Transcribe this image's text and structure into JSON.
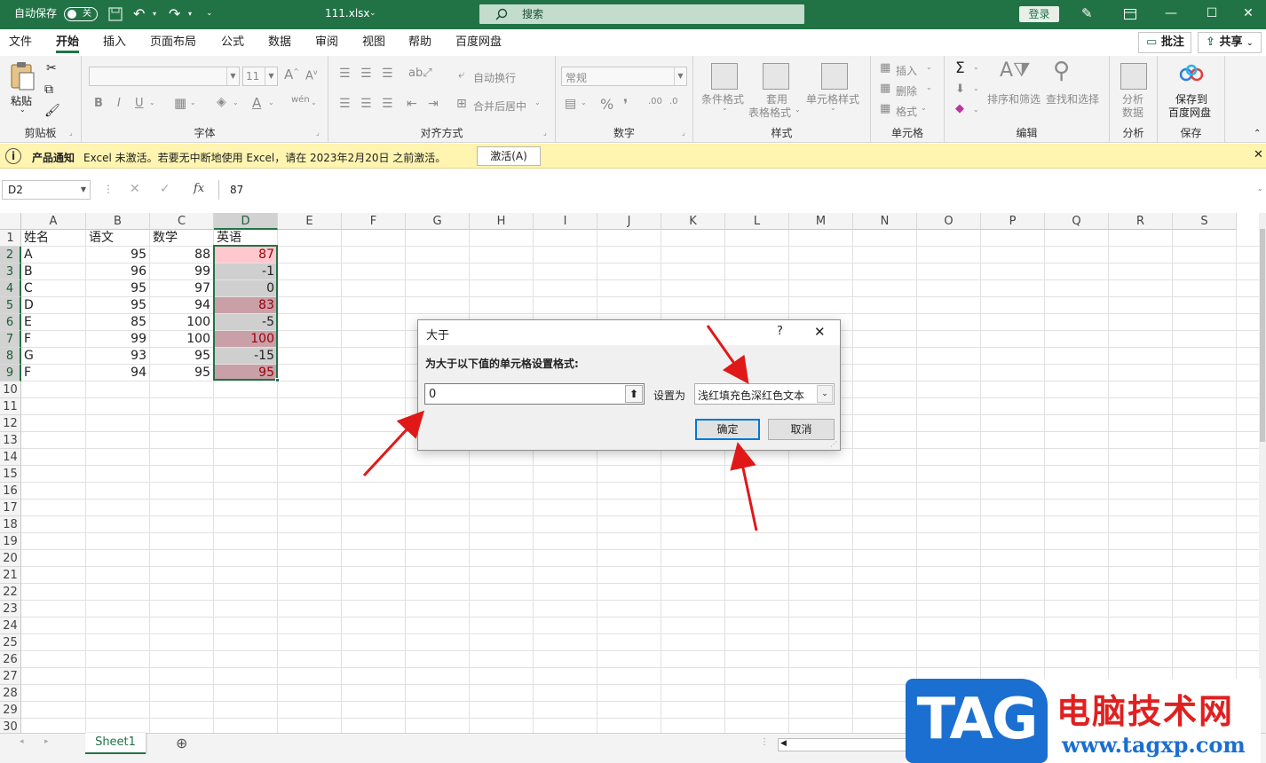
{
  "titlebar": {
    "autosave_label": "自动保存",
    "autosave_state": "关",
    "filename": "111.xlsx",
    "search_placeholder": "搜索",
    "login_label": "登录"
  },
  "menu": {
    "tabs": [
      "文件",
      "开始",
      "插入",
      "页面布局",
      "公式",
      "数据",
      "审阅",
      "视图",
      "帮助",
      "百度网盘"
    ],
    "active": "开始",
    "comment_label": "批注",
    "share_label": "共享"
  },
  "ribbon": {
    "paste_label": "粘贴",
    "clipboard_group": "剪贴板",
    "font_size": "11",
    "font_group": "字体",
    "wrap_text": "自动换行",
    "merge_center": "合并后居中",
    "align_group": "对齐方式",
    "number_format": "常规",
    "number_group": "数字",
    "cond_format": "条件格式",
    "table_format_1": "套用",
    "table_format_2": "表格格式",
    "cell_style": "单元格样式",
    "styles_group": "样式",
    "insert": "插入",
    "delete": "删除",
    "format": "格式",
    "cells_group": "单元格",
    "sort_filter": "排序和筛选",
    "find_select": "查找和选择",
    "editing_group": "编辑",
    "analyze_1": "分析",
    "analyze_2": "数据",
    "analysis_group": "分析",
    "save_baidu_1": "保存到",
    "save_baidu_2": "百度网盘",
    "save_group": "保存"
  },
  "notice": {
    "title": "产品通知",
    "message": "Excel 未激活。若要无中断地使用 Excel，请在 2023年2月20日 之前激活。",
    "button": "激活(A)"
  },
  "formula_bar": {
    "name_box": "D2",
    "fx": "fx",
    "value": "87"
  },
  "sheet": {
    "columns": [
      "A",
      "B",
      "C",
      "D",
      "E",
      "F",
      "G",
      "H",
      "I",
      "J",
      "K",
      "L",
      "M",
      "N",
      "O",
      "P",
      "Q",
      "R",
      "S"
    ],
    "row_numbers": [
      "1",
      "2",
      "3",
      "4",
      "5",
      "6",
      "7",
      "8",
      "9",
      "10",
      "11",
      "12",
      "13",
      "14",
      "15",
      "16",
      "17",
      "18",
      "19",
      "20",
      "21",
      "22",
      "23",
      "24",
      "25",
      "26",
      "27",
      "28",
      "29",
      "30"
    ],
    "header_row": [
      "姓名",
      "语文",
      "数学",
      "英语"
    ],
    "rows": [
      {
        "name": "A",
        "chinese": "95",
        "math": "88",
        "english": "87",
        "highlight": "light"
      },
      {
        "name": "B",
        "chinese": "96",
        "math": "99",
        "english": "-1",
        "highlight": "gray"
      },
      {
        "name": "C",
        "chinese": "95",
        "math": "97",
        "english": "0",
        "highlight": "gray"
      },
      {
        "name": "D",
        "chinese": "95",
        "math": "94",
        "english": "83",
        "highlight": "dark"
      },
      {
        "name": "E",
        "chinese": "85",
        "math": "100",
        "english": "-5",
        "highlight": "gray"
      },
      {
        "name": "F",
        "chinese": "99",
        "math": "100",
        "english": "100",
        "highlight": "dark"
      },
      {
        "name": "G",
        "chinese": "93",
        "math": "95",
        "english": "-15",
        "highlight": "gray"
      },
      {
        "name": "F",
        "chinese": "94",
        "math": "95",
        "english": "95",
        "highlight": "dark"
      }
    ],
    "colors": {
      "light": "#ffc7ce",
      "gray": "#cfcfcf",
      "dark": "#c9a0a8",
      "red_text": "#9c0006"
    }
  },
  "dialog": {
    "title": "大于",
    "help": "?",
    "prompt": "为大于以下值的单元格设置格式:",
    "input_value": "0",
    "set_as_label": "设置为",
    "format_option": "浅红填充色深红色文本",
    "ok": "确定",
    "cancel": "取消"
  },
  "sheet_tabs": {
    "active": "Sheet1"
  },
  "watermark": {
    "logo": "TAG",
    "site_name": "电脑技术网",
    "url": "www.tagxp.com"
  }
}
